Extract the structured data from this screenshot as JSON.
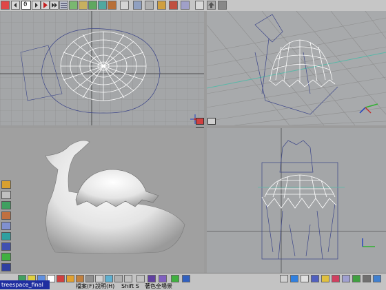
{
  "toolbar": {
    "frame_value": "0",
    "buttons": [
      "undo",
      "step-back",
      "rewind",
      "frame-field",
      "step-forward",
      "play",
      "go-to-end",
      "stop",
      "timeline",
      "edit-curve",
      "align",
      "weld",
      "bevel",
      "spline",
      "lathe",
      "view-layout",
      "wireframe",
      "render",
      "scale",
      "move",
      "rotate",
      "viewports",
      "cut",
      "light",
      "camera",
      "up-arrow",
      "color-grid"
    ]
  },
  "viewports": {
    "top": "top-view",
    "perspective": "perspective-view",
    "render": "shaded-render-view",
    "front": "front-view"
  },
  "statusbar": {
    "filename": "treespace_final",
    "menu_file": "檔案(F)",
    "menu_help": "說明(H)",
    "shortcut": "Shift S",
    "status_msg": "著色全場景"
  },
  "colors": {
    "viewport_bg": "#a4a6a8",
    "render_bg": "#a0a0a0",
    "grid": "#8c8c8c",
    "wire_white": "#ffffff",
    "wire_blue": "#3a4488"
  }
}
